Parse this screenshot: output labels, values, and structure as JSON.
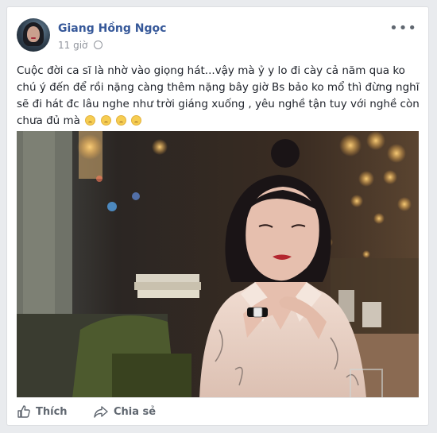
{
  "post": {
    "author": "Giang Hồng Ngọc",
    "time": "11 giờ",
    "text": "Cuộc đời ca sĩ là nhờ vào giọng hát...vậy mà ỷ y lo đi cày cả năm qua ko chú ý đến để rồi nặng càng thêm nặng bây giờ Bs bảo ko mổ thì đừng nghĩ sẽ đi hát đc lâu nghe như trời giáng xuống , yêu nghề tận tuy với nghề còn chưa đủ mà",
    "emoji_count": 4
  },
  "actions": {
    "like_label": "Thích",
    "share_label": "Chia sẻ"
  },
  "icons": {
    "more": "more-options-icon",
    "globe": "globe-icon",
    "like": "thumbs-up-icon",
    "share": "share-arrow-icon",
    "emoji": "sad-face-emoji"
  },
  "colors": {
    "link": "#365899",
    "muted": "#90949c",
    "action": "#606770"
  }
}
